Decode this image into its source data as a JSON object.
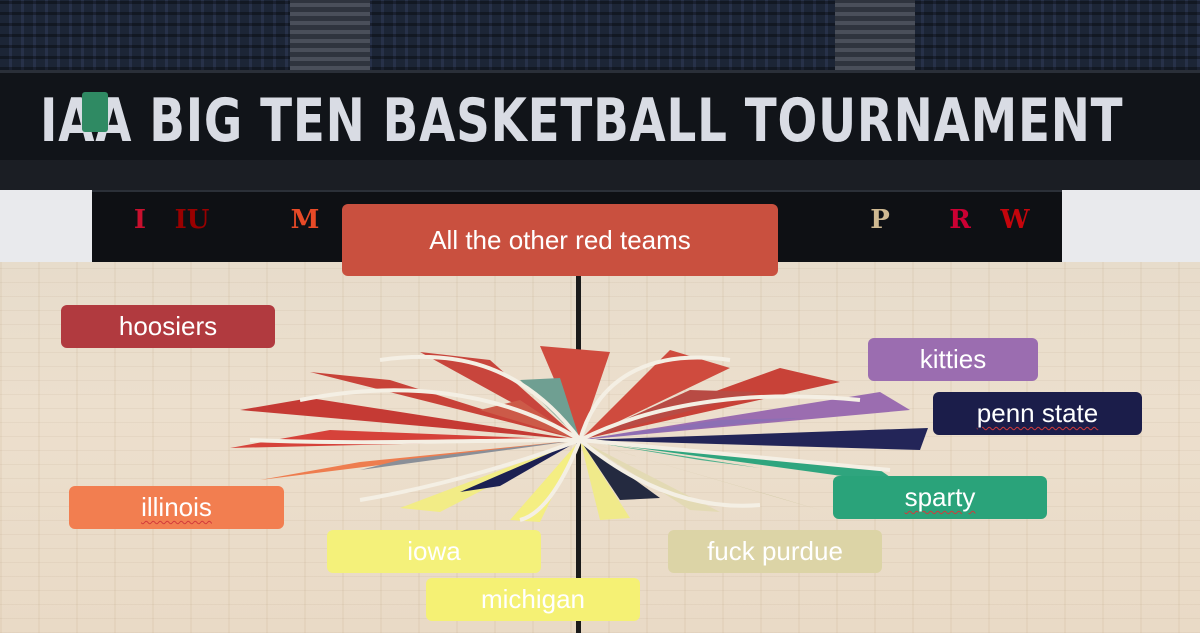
{
  "banner": {
    "text": "IAA BIG TEN BASKETBALL TOURNAMENT"
  },
  "team_logos": [
    {
      "text": "I",
      "color": "#c8102e"
    },
    {
      "text": "IU",
      "color": "#990000"
    },
    {
      "text": "M",
      "color": "#e84a27"
    },
    {
      "text": "P",
      "color": "#cfb991"
    },
    {
      "text": "R",
      "color": "#cc0033"
    },
    {
      "text": "W",
      "color": "#c5050c"
    }
  ],
  "labels": {
    "main": "All the other red teams",
    "hoosiers": "hoosiers",
    "kitties": "kitties",
    "penn_state": "penn state",
    "illinois": "illinois",
    "sparty": "sparty",
    "iowa": "iowa",
    "fuck_purdue": "fuck purdue",
    "michigan": "michigan"
  },
  "colors": {
    "red": "#c9503f",
    "hoosiers": "#b13a3f",
    "kitties": "#9b6db0",
    "penn_state": "#1b1d4a",
    "illinois": "#f27e50",
    "sparty": "#2aa37a",
    "iowa": "#f4f17a",
    "purdue": "#dcd4a6",
    "michigan": "#f5f174"
  }
}
